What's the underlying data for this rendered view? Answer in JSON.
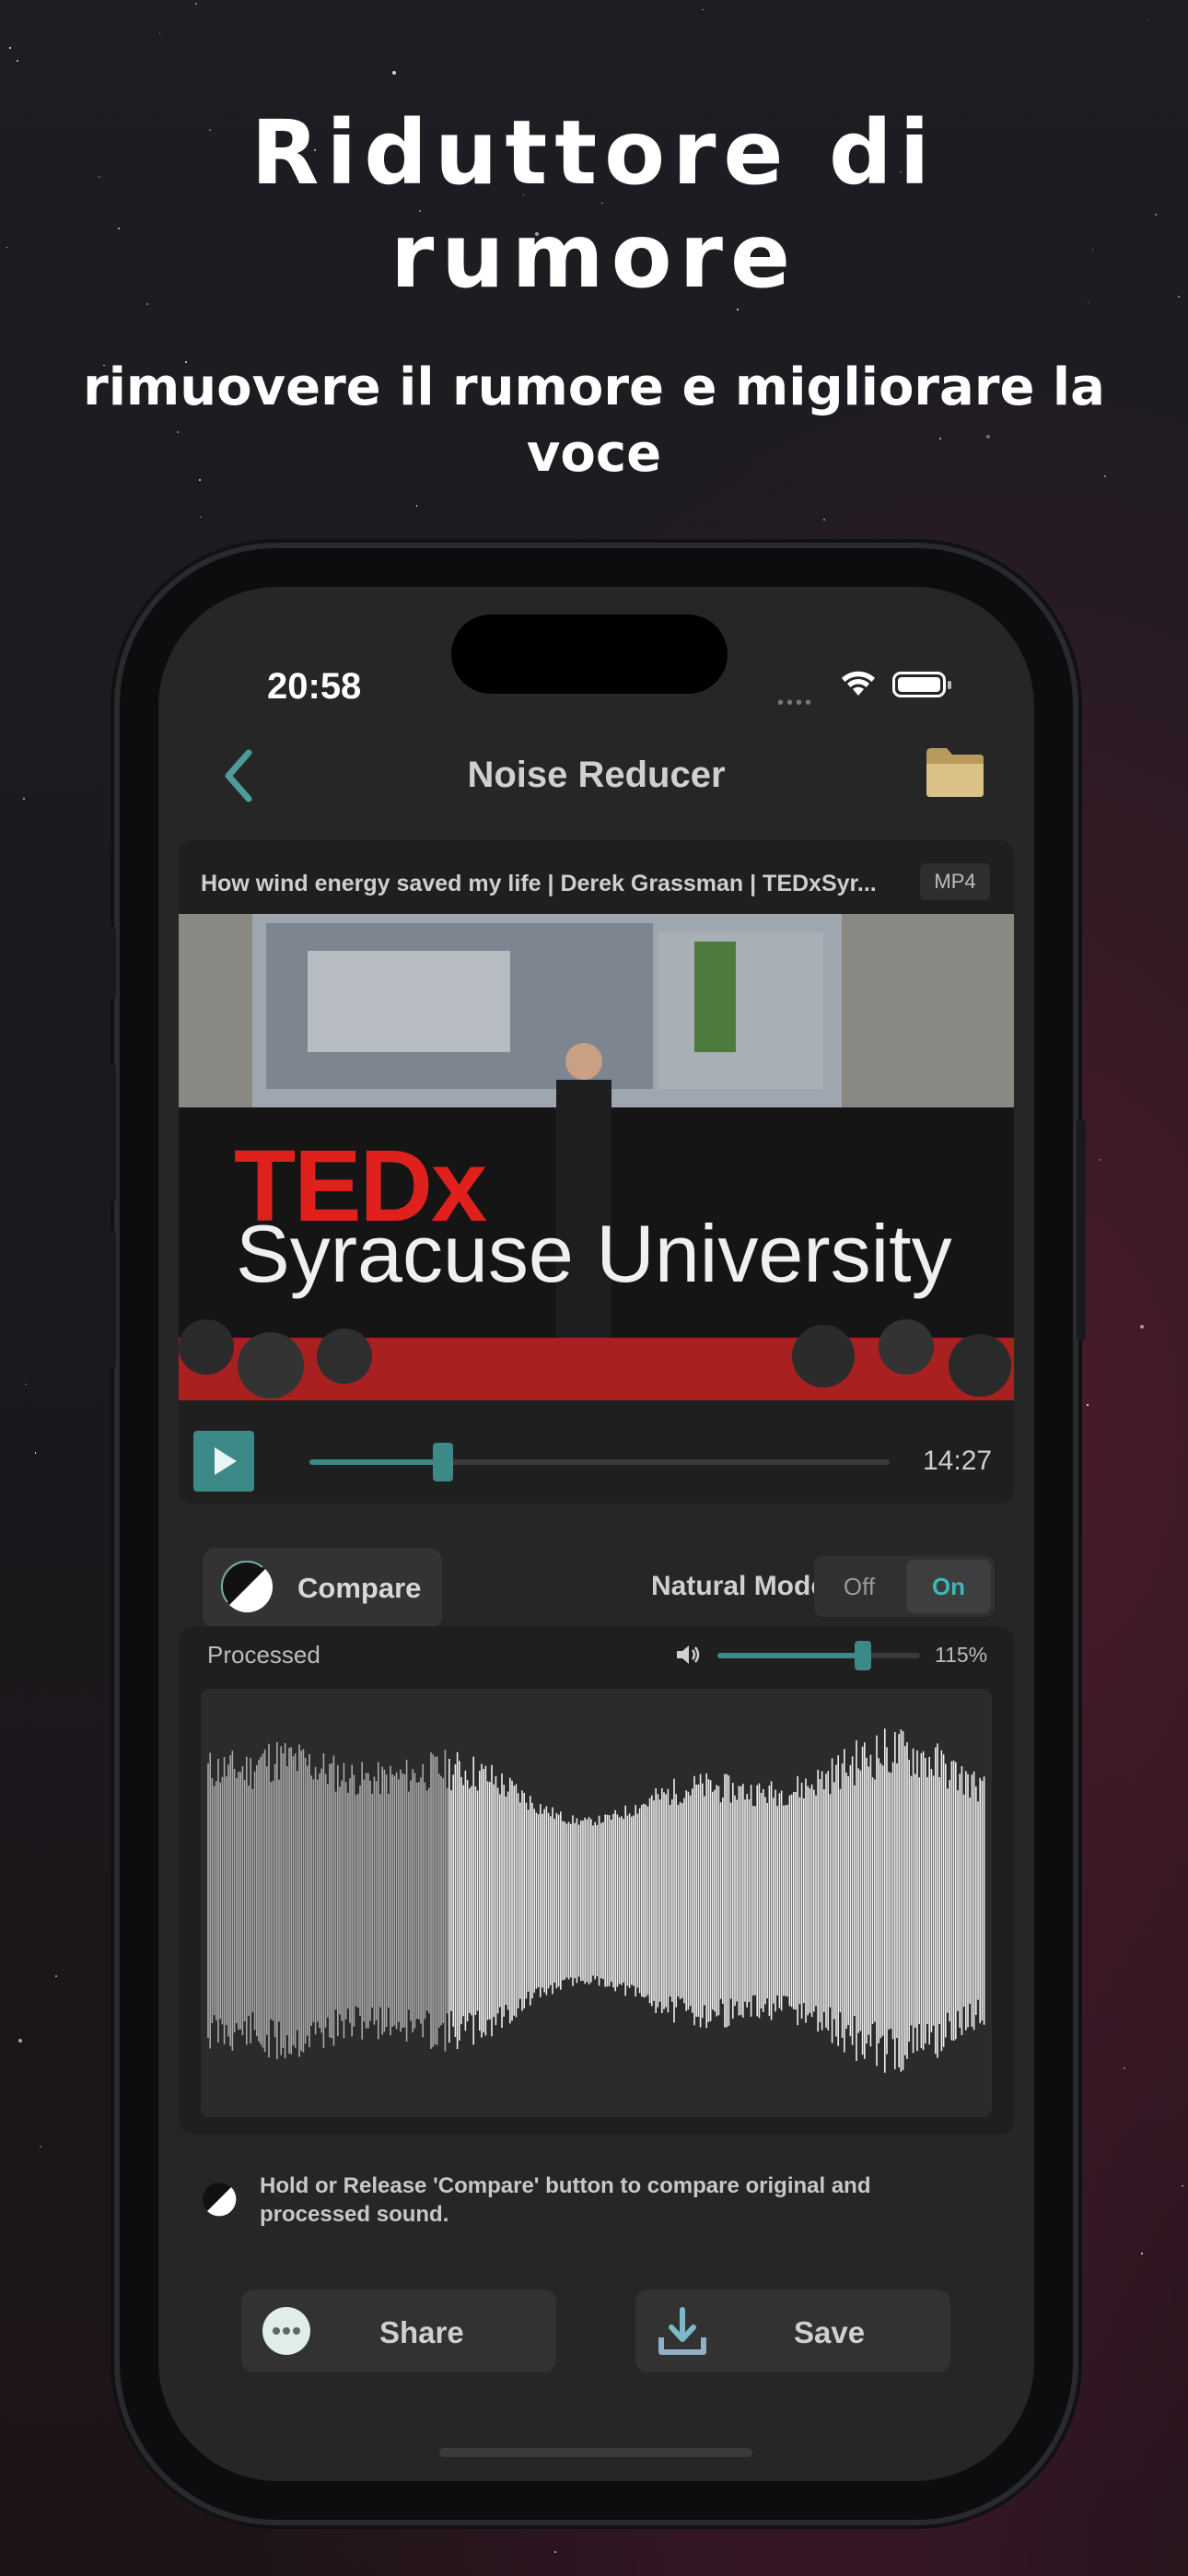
{
  "promo": {
    "title_line1": "Riduttore di",
    "title_line2": "rumore",
    "subtitle": "rimuovere il rumore e migliorare la voce"
  },
  "status_bar": {
    "time": "20:58"
  },
  "nav": {
    "title": "Noise Reducer",
    "back_icon": "chevron-left-icon",
    "folder_icon": "folder-icon"
  },
  "video": {
    "filename": "How wind energy saved my life | Derek Grassman | TEDxSyr...",
    "format": "MP4",
    "stage_brand": "TEDx",
    "stage_text": "Syracuse University",
    "duration": "14:27",
    "progress": 0.23
  },
  "controls": {
    "compare_label": "Compare",
    "natural_mode_label": "Natural Mode",
    "off_label": "Off",
    "on_label": "On",
    "natural_mode_selected": "On"
  },
  "waveform": {
    "label": "Processed",
    "volume_text": "115%",
    "volume_level": 0.72,
    "played_fraction": 0.31
  },
  "tip": {
    "text": "Hold or Release 'Compare' button to compare original and processed sound."
  },
  "actions": {
    "share_label": "Share",
    "save_label": "Save"
  },
  "colors": {
    "accent": "#3d8987",
    "accent_text": "#3fb7b2",
    "background": "#262627",
    "card": "#1f1f20"
  }
}
